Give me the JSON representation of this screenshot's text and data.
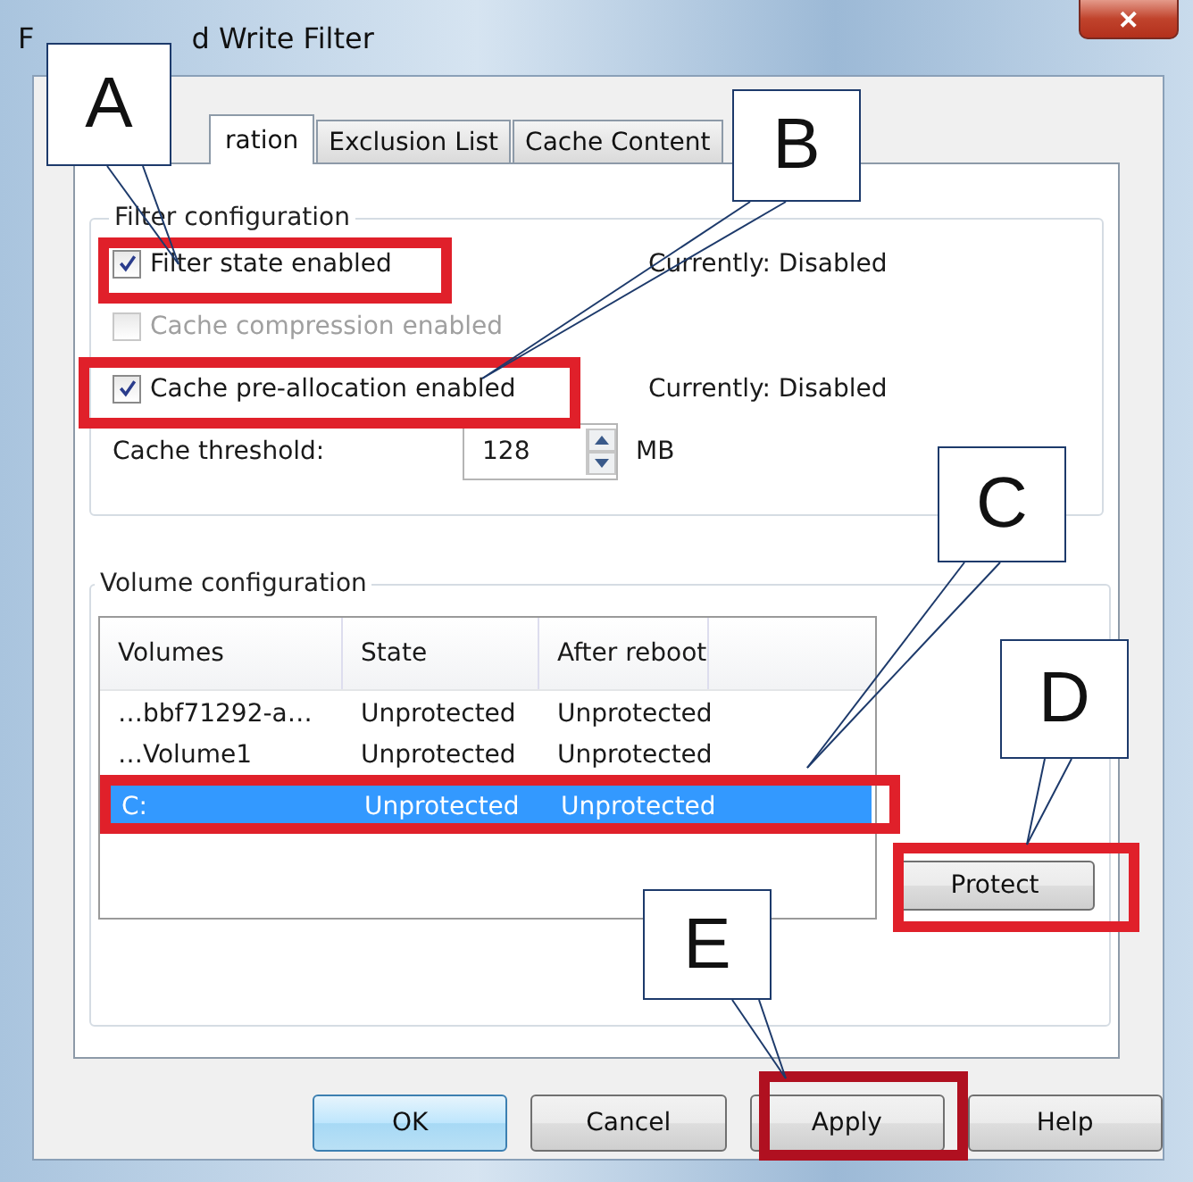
{
  "window": {
    "title_parts": [
      "F",
      "d Write Filter"
    ],
    "close": "✕"
  },
  "tabs": [
    {
      "label": "ration",
      "selected": true
    },
    {
      "label": "Exclusion List",
      "selected": false
    },
    {
      "label": "Cache Content",
      "selected": false
    }
  ],
  "filter_configuration": {
    "title": "Filter configuration",
    "options": [
      {
        "label": "Filter state enabled",
        "checked": true,
        "disabled": false,
        "status": "Currently: Disabled"
      },
      {
        "label": "Cache compression enabled",
        "checked": false,
        "disabled": true
      },
      {
        "label": "Cache pre-allocation enabled",
        "checked": true,
        "disabled": false,
        "status": "Currently: Disabled"
      }
    ],
    "threshold": {
      "label": "Cache threshold:",
      "value": "128",
      "unit": "MB"
    }
  },
  "volume_configuration": {
    "title": "Volume configuration",
    "columns": [
      "Volumes",
      "State",
      "After reboot"
    ],
    "rows": [
      {
        "cells": [
          "…bbf71292-a…",
          "Unprotected",
          "Unprotected"
        ],
        "selected": false
      },
      {
        "cells": [
          "…Volume1",
          "Unprotected",
          "Unprotected"
        ],
        "selected": false
      },
      {
        "cells": [
          "C:",
          "Unprotected",
          "Unprotected"
        ],
        "selected": true
      }
    ],
    "protect_button": "Protect"
  },
  "buttons": [
    {
      "label": "OK",
      "default": true
    },
    {
      "label": "Cancel",
      "default": false
    },
    {
      "label": "Apply",
      "default": false
    },
    {
      "label": "Help",
      "default": false
    }
  ],
  "callouts": [
    {
      "letter": "A"
    },
    {
      "letter": "B"
    },
    {
      "letter": "C"
    },
    {
      "letter": "D"
    },
    {
      "letter": "E"
    }
  ]
}
